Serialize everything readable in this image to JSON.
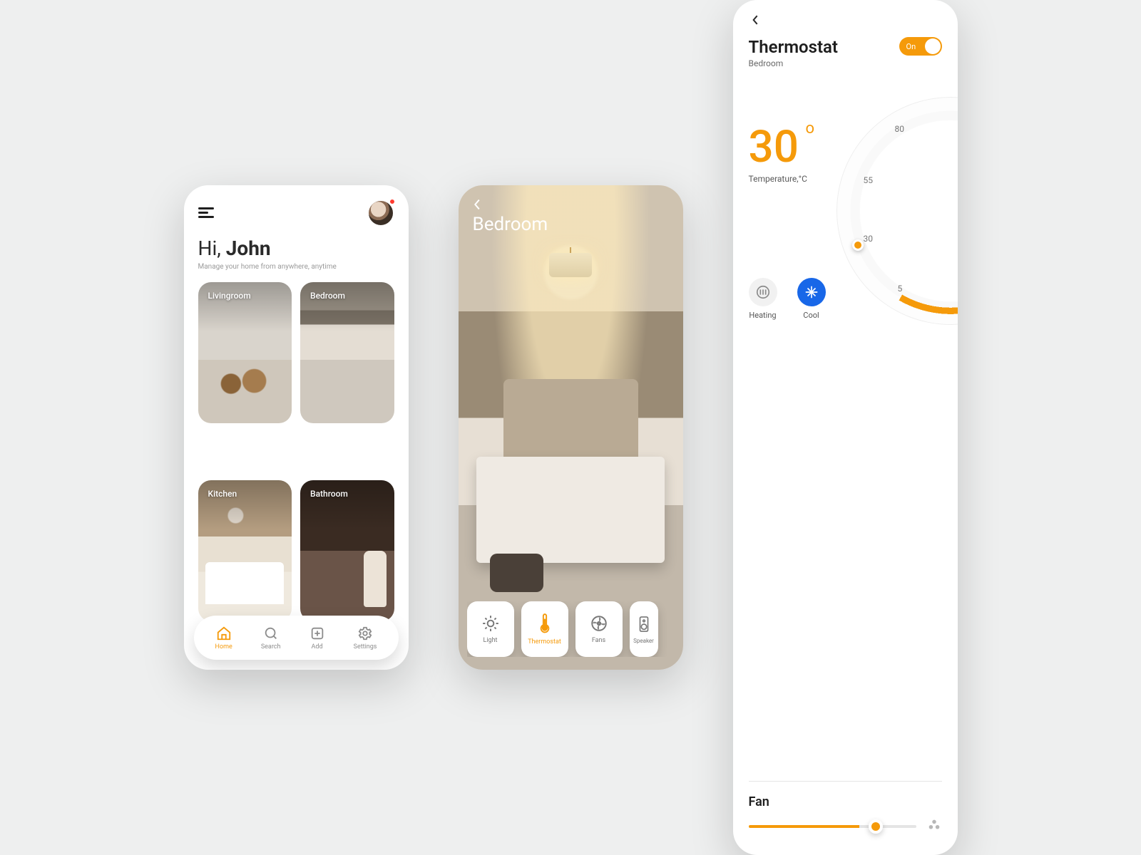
{
  "colors": {
    "accent": "#f59a0a",
    "cool": "#1867e8"
  },
  "screen1": {
    "greeting_prefix": "Hi, ",
    "greeting_name": "John",
    "subtitle": "Manage your home from anywhere, anytime",
    "rooms": [
      {
        "label": "Livingroom"
      },
      {
        "label": "Bedroom"
      },
      {
        "label": "Kitchen"
      },
      {
        "label": "Bathroom"
      }
    ],
    "nav": [
      {
        "label": "Home",
        "active": true
      },
      {
        "label": "Search",
        "active": false
      },
      {
        "label": "Add",
        "active": false
      },
      {
        "label": "Settings",
        "active": false
      }
    ]
  },
  "screen2": {
    "title": "Bedroom",
    "devices": [
      {
        "label": "Light",
        "active": false
      },
      {
        "label": "Thermostat",
        "active": true
      },
      {
        "label": "Fans",
        "active": false
      },
      {
        "label": "Speaker",
        "active": false
      }
    ]
  },
  "screen3": {
    "title": "Thermostat",
    "room": "Bedroom",
    "toggle_label": "On",
    "toggle_state": true,
    "temperature_value": "30",
    "temperature_degree": "o",
    "temperature_label": "Temperature,°C",
    "dial_ticks": [
      "80",
      "55",
      "30",
      "5"
    ],
    "modes": [
      {
        "label": "Heating"
      },
      {
        "label": "Cool"
      }
    ],
    "fan_label": "Fan",
    "fan_value_pct": 66
  }
}
